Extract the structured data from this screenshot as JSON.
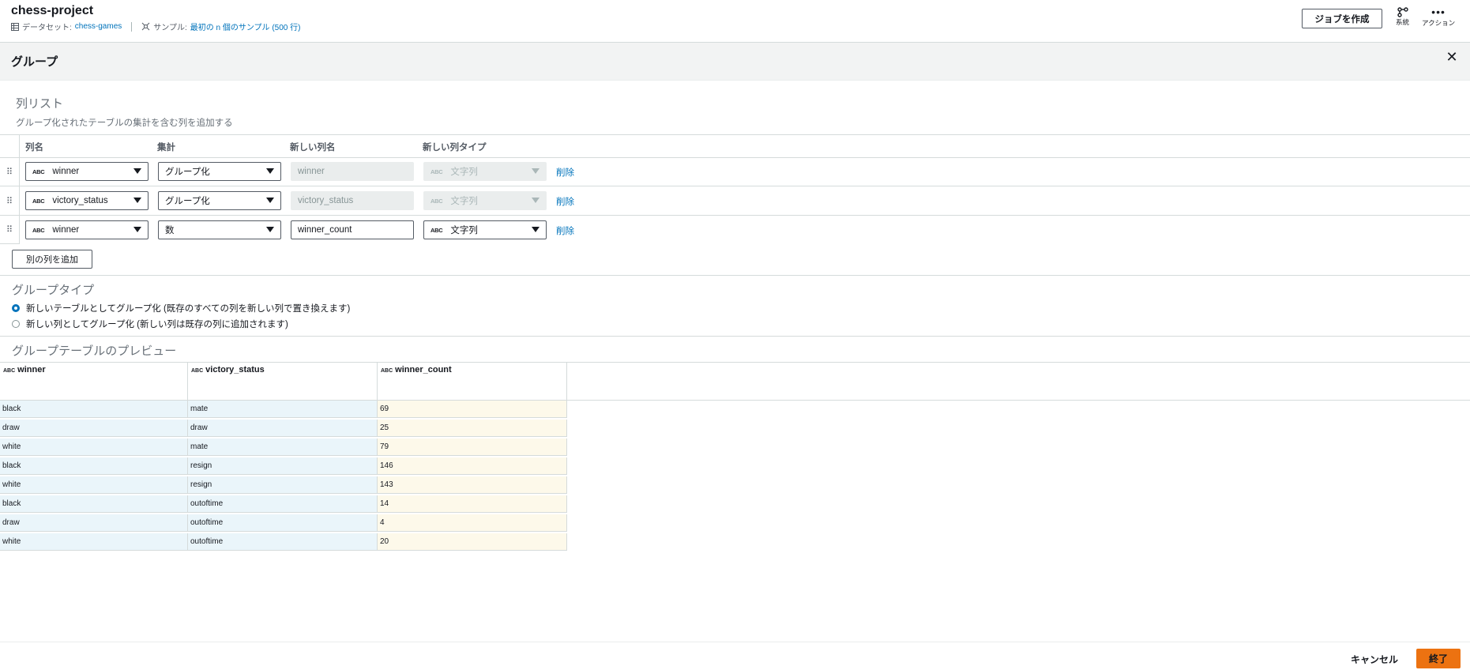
{
  "header": {
    "project_title": "chess-project",
    "dataset_label": "データセット:",
    "dataset_name": "chess-games",
    "sample_label": "サンプル:",
    "sample_value": "最初の n 個のサンプル (500 行)",
    "create_job_label": "ジョブを作成",
    "lineage_label": "系統",
    "actions_label": "アクション"
  },
  "panel": {
    "title": "グループ"
  },
  "column_list": {
    "title": "列リスト",
    "subtitle": "グループ化されたテーブルの集計を含む列を追加する",
    "headers": {
      "column_name": "列名",
      "aggregate": "集計",
      "new_column_name": "新しい列名",
      "new_column_type": "新しい列タイプ"
    },
    "rows": [
      {
        "column": "winner",
        "aggregate": "グループ化",
        "new_name": "winner",
        "new_type": "文字列",
        "delete": "削除",
        "type_tag": "ABC"
      },
      {
        "column": "victory_status",
        "aggregate": "グループ化",
        "new_name": "victory_status",
        "new_type": "文字列",
        "delete": "削除",
        "type_tag": "ABC"
      },
      {
        "column": "winner",
        "aggregate": "数",
        "new_name": "winner_count",
        "new_type": "文字列",
        "delete": "削除",
        "type_tag": "ABC"
      }
    ],
    "add_column_label": "別の列を追加"
  },
  "group_type": {
    "title": "グループタイプ",
    "options": [
      {
        "label": "新しいテーブルとしてグループ化 (既存のすべての列を新しい列で置き換えます)",
        "selected": true
      },
      {
        "label": "新しい列としてグループ化 (新しい列は既存の列に追加されます)",
        "selected": false
      }
    ]
  },
  "preview": {
    "title": "グループテーブルのプレビュー",
    "type_tag": "ABC",
    "columns": [
      "winner",
      "victory_status",
      "winner_count"
    ],
    "rows": [
      [
        "black",
        "mate",
        "69"
      ],
      [
        "draw",
        "draw",
        "25"
      ],
      [
        "white",
        "mate",
        "79"
      ],
      [
        "black",
        "resign",
        "146"
      ],
      [
        "white",
        "resign",
        "143"
      ],
      [
        "black",
        "outoftime",
        "14"
      ],
      [
        "draw",
        "outoftime",
        "4"
      ],
      [
        "white",
        "outoftime",
        "20"
      ]
    ]
  },
  "footer": {
    "cancel_label": "キャンセル",
    "finish_label": "終了"
  },
  "colors": {
    "accent": "#0073bb",
    "primary_button": "#ec7211",
    "preview_group_bg": "#eaf5fa",
    "preview_new_bg": "#fdf9ea"
  }
}
